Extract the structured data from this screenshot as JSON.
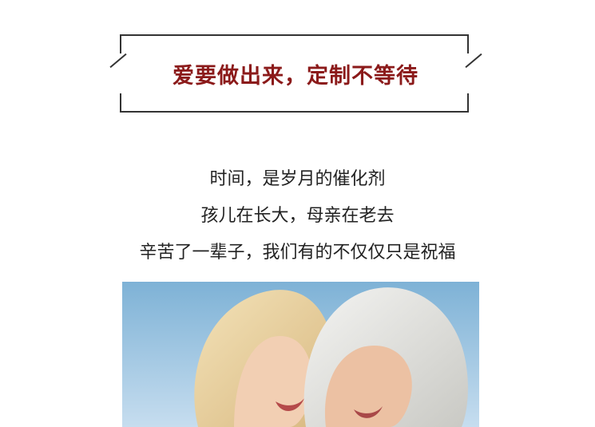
{
  "header": {
    "headline": "爱要做出来，定制不等待"
  },
  "poem": {
    "line1": "时间，是岁月的催化剂",
    "line2": "孩儿在长大，母亲在老去",
    "line3": "辛苦了一辈子，我们有的不仅仅只是祝福"
  },
  "photo": {
    "subject": "mother-and-daughter-photo"
  },
  "colors": {
    "headline": "#8b1a1a",
    "frame": "#333333",
    "text": "#222222",
    "sky": "#a9cde4"
  }
}
